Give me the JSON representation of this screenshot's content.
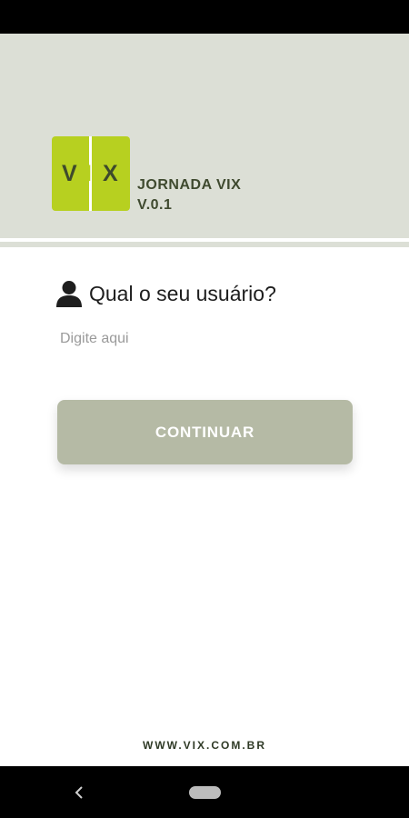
{
  "header": {
    "logo_letters": [
      "V",
      "I",
      "X"
    ],
    "app_title": "JORNADA VIX",
    "app_version": "V.0.1",
    "background_color": "#dcdfd6",
    "logo_color": "#b7d020"
  },
  "login": {
    "user_icon": "user-icon",
    "question": "Qual o seu usuário?",
    "input_placeholder": "Digite aqui",
    "input_value": "",
    "continue_label": "CONTINUAR",
    "button_color": "#b5baa5"
  },
  "footer": {
    "url": "WWW.VIX.COM.BR"
  },
  "system_nav": {
    "back_icon": "back-chevron-icon",
    "home_icon": "home-pill-icon"
  }
}
